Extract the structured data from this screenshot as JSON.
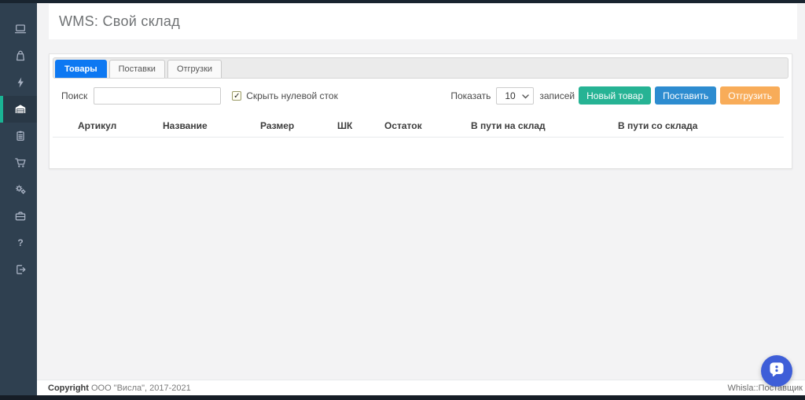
{
  "page": {
    "title": "WMS: Свой склад"
  },
  "sidebar": {
    "items": [
      {
        "icon": "monitor-icon",
        "active": false
      },
      {
        "icon": "bag-icon",
        "active": false
      },
      {
        "icon": "bolt-icon",
        "active": false
      },
      {
        "icon": "warehouse-icon",
        "active": true
      },
      {
        "icon": "clipboard-icon",
        "active": false
      },
      {
        "icon": "cart-icon",
        "active": false
      },
      {
        "icon": "cogs-icon",
        "active": false
      },
      {
        "icon": "briefcase-icon",
        "active": false
      },
      {
        "icon": "help-icon",
        "active": false
      },
      {
        "icon": "logout-icon",
        "active": false
      }
    ]
  },
  "tabs": [
    {
      "label": "Товары",
      "active": true
    },
    {
      "label": "Поставки",
      "active": false
    },
    {
      "label": "Отгрузки",
      "active": false
    }
  ],
  "toolbar": {
    "search_label": "Поиск",
    "search_value": "",
    "checkbox_label": "Скрыть нулевой сток",
    "checkbox_checked": true,
    "check_glyph": "✓",
    "show_label": "Показать",
    "page_size": "10",
    "records_label": "записей",
    "buttons": [
      {
        "label": "Новый товар",
        "color": "#26b394"
      },
      {
        "label": "Поставить",
        "color": "#2d8cd0"
      },
      {
        "label": "Отгрузить",
        "color": "#f8ac59"
      }
    ]
  },
  "table": {
    "headers": [
      "Артикул",
      "Название",
      "Размер",
      "ШК",
      "Остаток",
      "В пути на склад",
      "В пути со склада"
    ],
    "rows": []
  },
  "footer": {
    "copyright_bold": "Copyright",
    "copyright_text": "ООО \"Висла\", 2017-2021",
    "right_text": "Whisla::Поставщик"
  },
  "colors": {
    "sidebar_bg": "#2f4050",
    "sidebar_active_accent": "#1ab394",
    "active_tab_blue": "#0d78f2",
    "button_green": "#26b394",
    "button_blue": "#2d8cd0",
    "button_orange": "#f8ac59",
    "chat_blue": "#3e5ed8",
    "page_bg": "#f3f3f4"
  }
}
